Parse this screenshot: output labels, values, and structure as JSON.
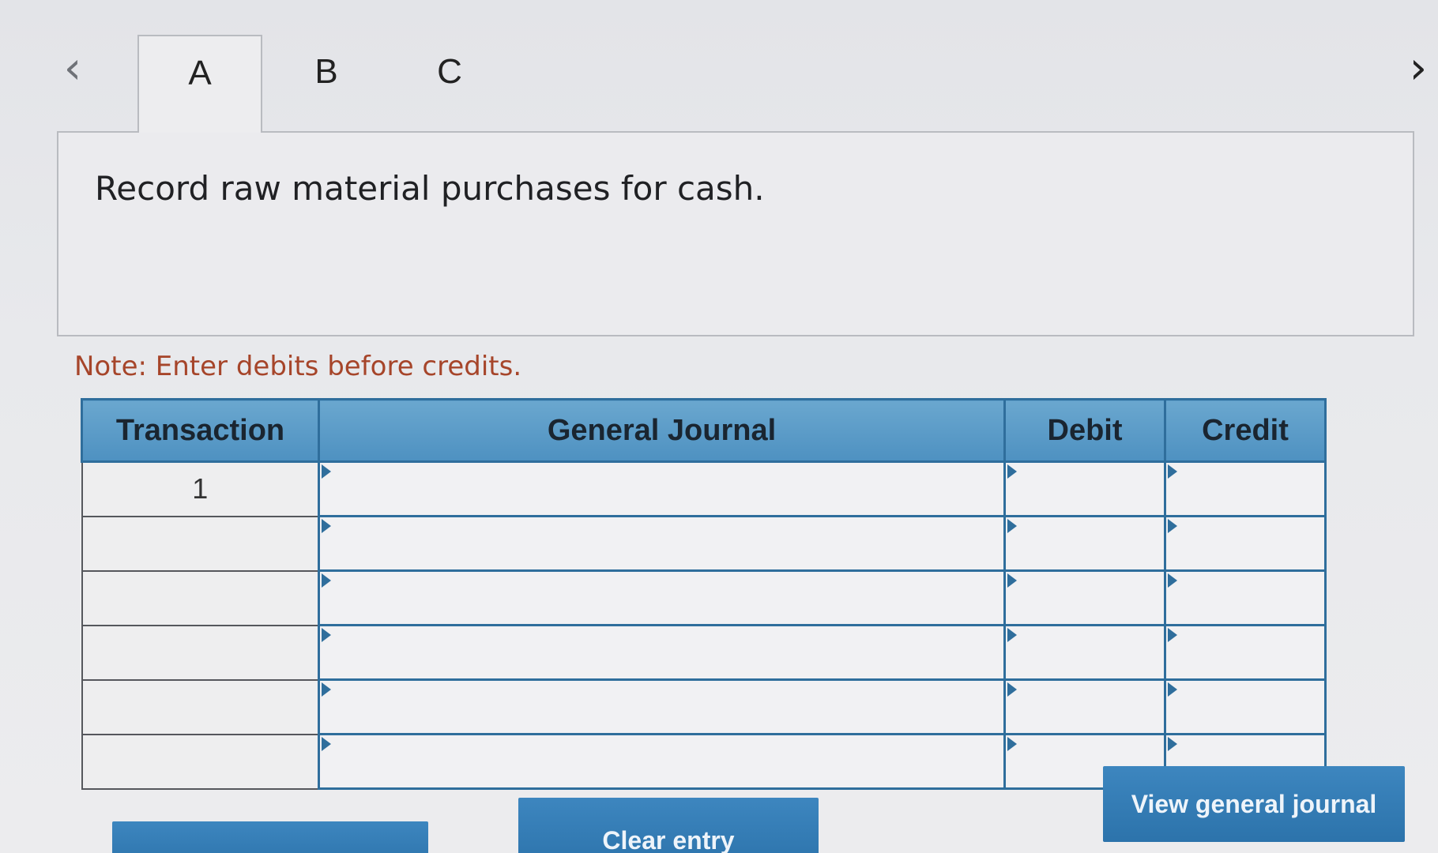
{
  "tabs": [
    {
      "label": "A",
      "active": true
    },
    {
      "label": "B",
      "active": false
    },
    {
      "label": "C",
      "active": false
    }
  ],
  "nav": {
    "prev_glyph": "‹",
    "next_glyph": "›"
  },
  "instruction": "Record raw material purchases for cash.",
  "note": "Note: Enter debits before credits.",
  "table": {
    "headers": {
      "transaction": "Transaction",
      "general_journal": "General Journal",
      "debit": "Debit",
      "credit": "Credit"
    },
    "rows": [
      {
        "transaction": "1",
        "account": "",
        "debit": "",
        "credit": ""
      },
      {
        "transaction": "",
        "account": "",
        "debit": "",
        "credit": ""
      },
      {
        "transaction": "",
        "account": "",
        "debit": "",
        "credit": ""
      },
      {
        "transaction": "",
        "account": "",
        "debit": "",
        "credit": ""
      },
      {
        "transaction": "",
        "account": "",
        "debit": "",
        "credit": ""
      },
      {
        "transaction": "",
        "account": "",
        "debit": "",
        "credit": ""
      }
    ]
  },
  "buttons": {
    "clear": "Clear entry",
    "view": "View general journal"
  },
  "colors": {
    "header_blue": "#4e91c1",
    "border_blue": "#2f6e9c",
    "button_blue": "#2c73ab",
    "note_red": "#a6452a"
  }
}
